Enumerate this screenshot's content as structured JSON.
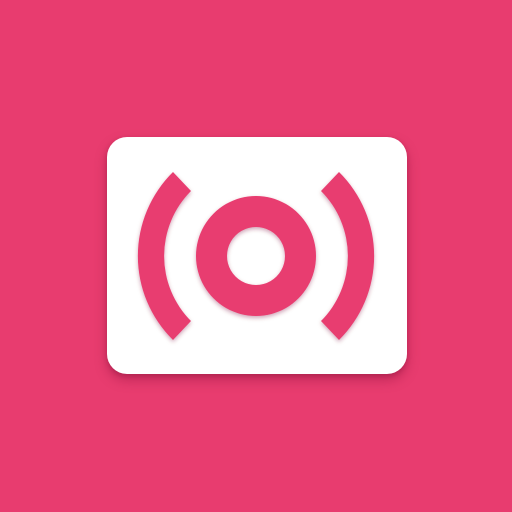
{
  "icon": {
    "name": "broadcast-signal",
    "background_color": "#e83c6f",
    "card_color": "#ffffff",
    "glyph_color": "#e83c6f"
  }
}
